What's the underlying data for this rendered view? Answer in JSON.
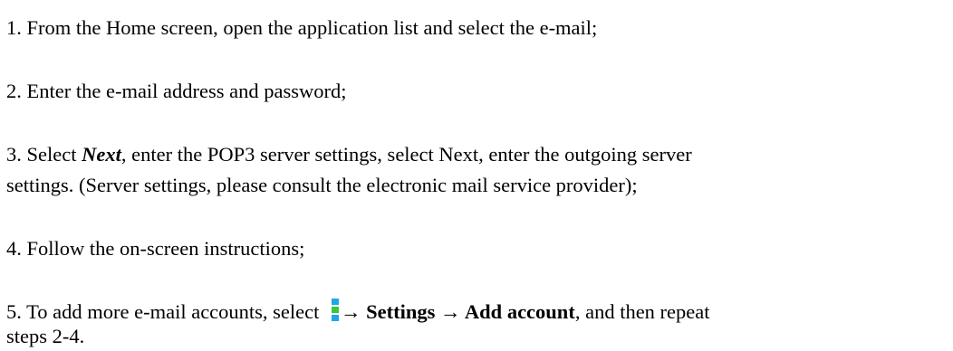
{
  "steps": {
    "s1": "1. From the Home screen, open the application list and select the e-mail;",
    "s2": "2. Enter the e-mail address and password;",
    "s3": {
      "prefix": "3. Select ",
      "next": "Next",
      "rest": ", enter the POP3 server settings, select Next, enter the outgoing server",
      "line2": "settings. (Server settings, please consult the electronic mail service provider);"
    },
    "s4": "4. Follow the on-screen instructions;",
    "s5": {
      "prefix": "5. To add more e-mail accounts, select ",
      "arrow1": "→ ",
      "settings": "Settings",
      "arrow2": " → ",
      "add_account": "Add account",
      "rest": ", and then repeat",
      "line2": "steps 2-4."
    }
  },
  "icons": {
    "menu": "menu-dots-icon"
  },
  "colors": {
    "menu_icon_top": "#21a6e8",
    "menu_icon_mid": "#3cc63c",
    "menu_icon_bottom": "#21a6e8",
    "text": "#000000"
  }
}
